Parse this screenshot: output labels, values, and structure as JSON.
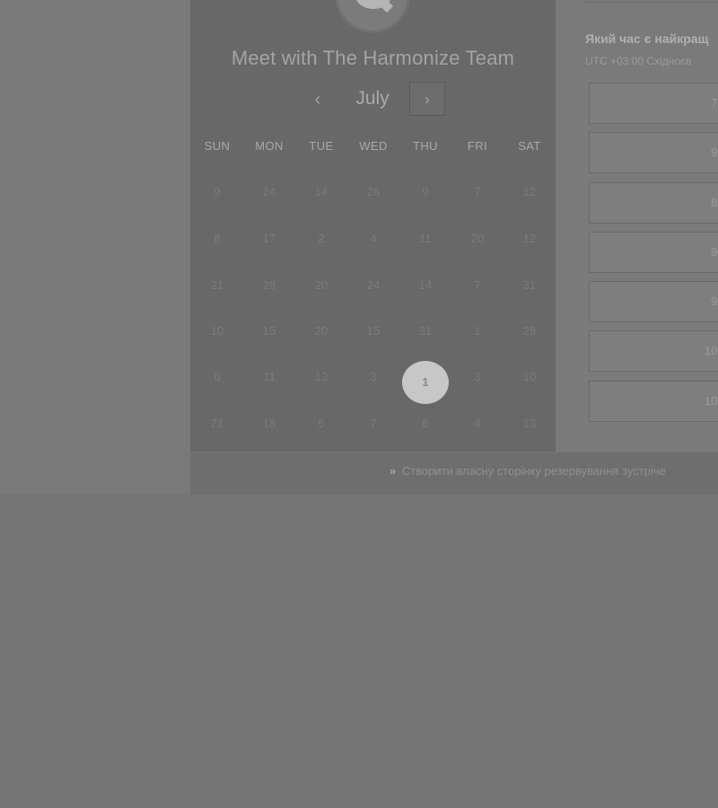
{
  "header": {
    "logo": "chat-bubble-logo",
    "logo_text": "...",
    "title": "Meet with The Harmonize Team"
  },
  "calendar": {
    "month": "July",
    "prev_icon": "‹",
    "next_icon": "›",
    "weekdays": [
      "SUN",
      "MON",
      "TUE",
      "WED",
      "THU",
      "FRI",
      "SAT"
    ],
    "weeks": [
      [
        "9",
        "24",
        "14",
        "26",
        "9",
        "7",
        "12"
      ],
      [
        "8",
        "17",
        "2",
        "4",
        "11",
        "20",
        "12"
      ],
      [
        "21",
        "28",
        "20",
        "24",
        "14",
        "7",
        "31"
      ],
      [
        "10",
        "15",
        "20",
        "15",
        "31",
        "1",
        "28"
      ],
      [
        "6",
        "11",
        "13",
        "3",
        "1",
        "3",
        "10"
      ],
      [
        "21",
        "18",
        "5",
        "7",
        "6",
        "4",
        "13"
      ]
    ],
    "selected_day": "1",
    "selected_position": {
      "week": 4,
      "day": 4
    }
  },
  "time_panel": {
    "question": "Який час є найкращ",
    "timezone": "UTC +03:00 Східноєв",
    "slots": [
      "7:",
      "9:",
      "8:",
      "9:",
      "9:",
      "10:",
      "10:"
    ]
  },
  "footer": {
    "link_icon": "»",
    "link_text": "Створити власну сторінку резервування зустріче"
  },
  "colors": {
    "overlay": "#747474",
    "panel": "#686868",
    "selected": "#c7c7c7"
  }
}
